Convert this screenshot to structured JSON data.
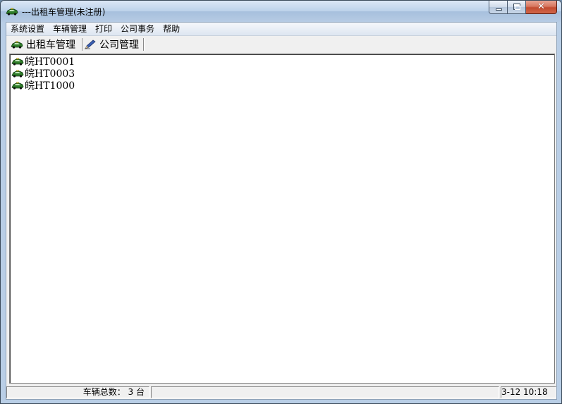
{
  "window": {
    "title": "---出租车管理(未注册)",
    "icon": "taxi-car-icon"
  },
  "menu": {
    "items": [
      {
        "label": "系统设置"
      },
      {
        "label": "车辆管理"
      },
      {
        "label": "打印"
      },
      {
        "label": "公司事务"
      },
      {
        "label": "帮助"
      }
    ]
  },
  "tabs": [
    {
      "label": "出租车管理",
      "icon": "taxi-car-icon"
    },
    {
      "label": "公司管理",
      "icon": "pen-icon"
    }
  ],
  "tree": {
    "items": [
      {
        "label": "皖HT0001",
        "icon": "taxi-car-icon"
      },
      {
        "label": "皖HT0003",
        "icon": "taxi-car-icon"
      },
      {
        "label": "皖HT1000",
        "icon": "taxi-car-icon"
      }
    ]
  },
  "status": {
    "vehicle_count": "车辆总数： 3 台",
    "middle": "",
    "datetime": "3-12 10:18"
  },
  "colors": {
    "titlebar": "#bcd2ea",
    "close_button": "#c24a2f",
    "car_green": "#2f7d2a"
  }
}
